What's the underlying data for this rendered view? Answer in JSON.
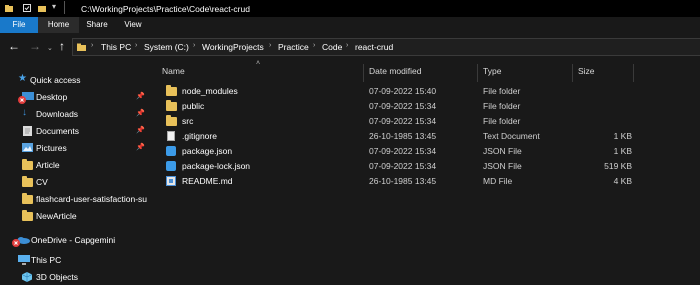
{
  "window": {
    "title_path": "C:\\WorkingProjects\\Practice\\Code\\react-crud"
  },
  "ribbon": {
    "tabs": [
      "File",
      "Home",
      "Share",
      "View"
    ]
  },
  "address": {
    "crumbs": [
      "This PC",
      "System (C:)",
      "WorkingProjects",
      "Practice",
      "Code",
      "react-crud"
    ]
  },
  "nav": {
    "items": [
      {
        "label": "Quick access",
        "icon": "star-icon"
      },
      {
        "label": "Desktop",
        "icon": "desktop-icon",
        "pinned": true
      },
      {
        "label": "Downloads",
        "icon": "download-icon",
        "pinned": true
      },
      {
        "label": "Documents",
        "icon": "documents-icon",
        "pinned": true
      },
      {
        "label": "Pictures",
        "icon": "pictures-icon",
        "pinned": true
      },
      {
        "label": "Article",
        "icon": "folder-icon"
      },
      {
        "label": "CV",
        "icon": "folder-icon"
      },
      {
        "label": "flashcard-user-satisfaction-su",
        "icon": "folder-icon"
      },
      {
        "label": "NewArticle",
        "icon": "folder-icon"
      },
      {
        "label": "OneDrive - Capgemini",
        "icon": "onedrive-icon"
      },
      {
        "label": "This PC",
        "icon": "computer-icon"
      },
      {
        "label": "3D Objects",
        "icon": "3d-objects-icon"
      }
    ]
  },
  "columns": {
    "name": "Name",
    "date": "Date modified",
    "type": "Type",
    "size": "Size"
  },
  "files": [
    {
      "name": "node_modules",
      "date": "07-09-2022 15:40",
      "type": "File folder",
      "size": "",
      "icon": "folder-icon"
    },
    {
      "name": "public",
      "date": "07-09-2022 15:34",
      "type": "File folder",
      "size": "",
      "icon": "folder-icon"
    },
    {
      "name": "src",
      "date": "07-09-2022 15:34",
      "type": "File folder",
      "size": "",
      "icon": "folder-icon"
    },
    {
      "name": ".gitignore",
      "date": "26-10-1985 13:45",
      "type": "Text Document",
      "size": "1 KB",
      "icon": "text-file-icon"
    },
    {
      "name": "package.json",
      "date": "07-09-2022 15:34",
      "type": "JSON File",
      "size": "1 KB",
      "icon": "vscode-file-icon"
    },
    {
      "name": "package-lock.json",
      "date": "07-09-2022 15:34",
      "type": "JSON File",
      "size": "519 KB",
      "icon": "vscode-file-icon"
    },
    {
      "name": "README.md",
      "date": "26-10-1985 13:45",
      "type": "MD File",
      "size": "4 KB",
      "icon": "markdown-file-icon"
    }
  ],
  "colors": {
    "accent": "#1979ca",
    "folder": "#e8c15a",
    "background": "#191919"
  }
}
